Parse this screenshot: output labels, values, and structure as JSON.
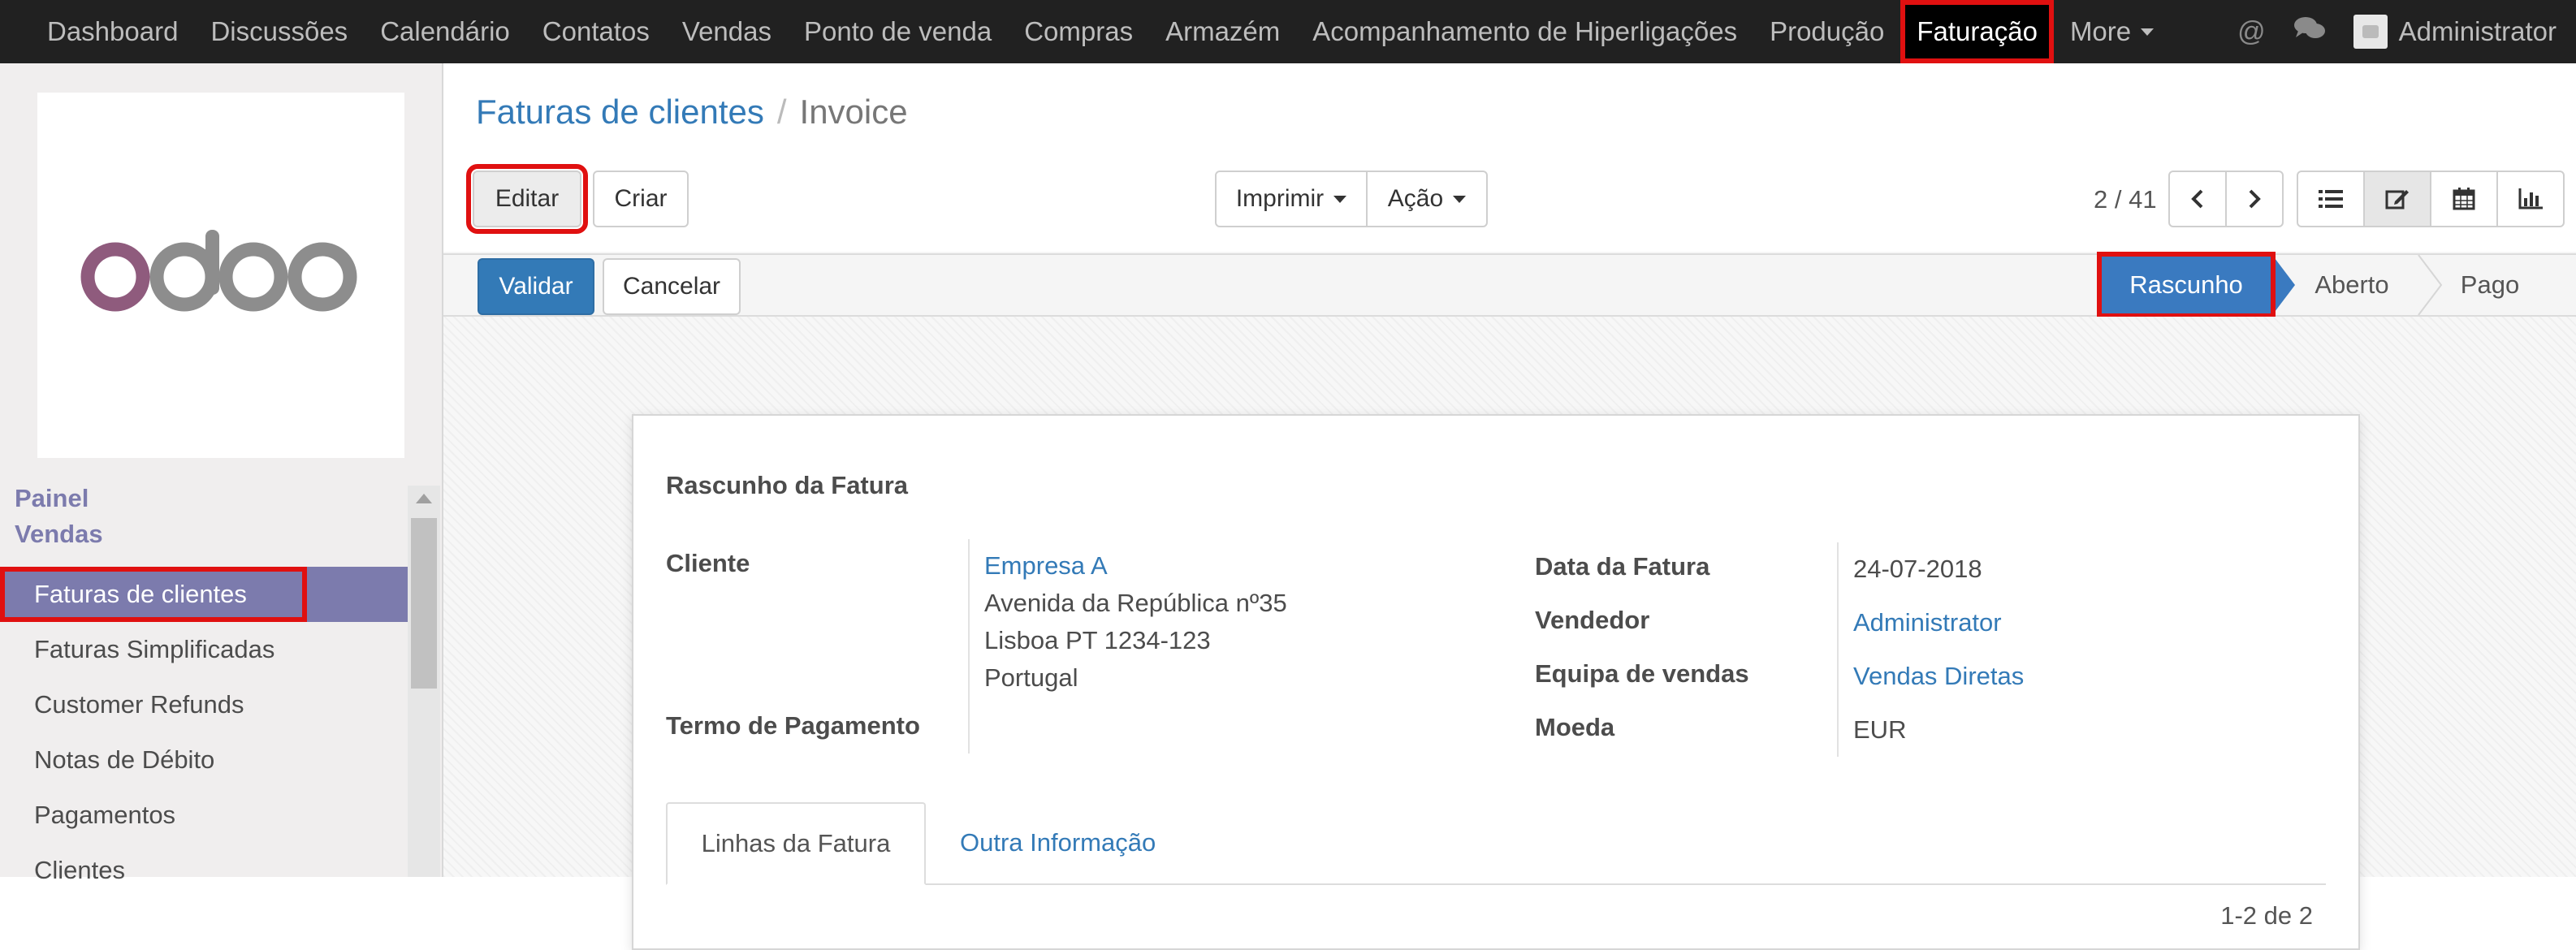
{
  "topbar": {
    "menu": [
      {
        "label": "Dashboard"
      },
      {
        "label": "Discussões"
      },
      {
        "label": "Calendário"
      },
      {
        "label": "Contatos"
      },
      {
        "label": "Vendas"
      },
      {
        "label": "Ponto de venda"
      },
      {
        "label": "Compras"
      },
      {
        "label": "Armazém"
      },
      {
        "label": "Acompanhamento de Hiperligações"
      },
      {
        "label": "Produção"
      },
      {
        "label": "Faturação"
      },
      {
        "label": "More"
      }
    ],
    "active_item": "Faturação",
    "user_name": "Administrator",
    "icons": [
      "at-icon",
      "chat-icon",
      "avatar-icon"
    ]
  },
  "sidebar": {
    "logo_text": "odoo",
    "sections": [
      "Painel",
      "Vendas"
    ],
    "items": [
      {
        "label": "Faturas de clientes"
      },
      {
        "label": "Faturas Simplificadas"
      },
      {
        "label": "Customer Refunds"
      },
      {
        "label": "Notas de Débito"
      },
      {
        "label": "Pagamentos"
      },
      {
        "label": "Clientes"
      }
    ]
  },
  "breadcrumb": {
    "parent": "Faturas de clientes",
    "separator": "/",
    "current": "Invoice"
  },
  "toolbar": {
    "edit_label": "Editar",
    "create_label": "Criar",
    "print_label": "Imprimir",
    "action_label": "Ação",
    "pager": "2 / 41"
  },
  "status": {
    "validate_label": "Validar",
    "cancel_label": "Cancelar",
    "stages": [
      "Rascunho",
      "Aberto",
      "Pago"
    ],
    "current_stage": "Rascunho"
  },
  "invoice": {
    "title": "Rascunho da Fatura",
    "customer_label": "Cliente",
    "customer_name": "Empresa A",
    "customer_address": [
      "Avenida da República nº35",
      "Lisboa PT 1234-123",
      "Portugal"
    ],
    "payment_term_label": "Termo de Pagamento",
    "date_label": "Data da Fatura",
    "date_value": "24-07-2018",
    "salesperson_label": "Vendedor",
    "salesperson_value": "Administrator",
    "team_label": "Equipa de vendas",
    "team_value": "Vendas Diretas",
    "currency_label": "Moeda",
    "currency_value": "EUR"
  },
  "tabs": {
    "lines_label": "Linhas da Fatura",
    "other_label": "Outra Informação"
  },
  "lines": {
    "counter": "1-2 de 2"
  },
  "colors": {
    "brand": "#7c7bad",
    "link": "#337ab7",
    "highlight": "#e01010",
    "topbar": "#212121"
  }
}
